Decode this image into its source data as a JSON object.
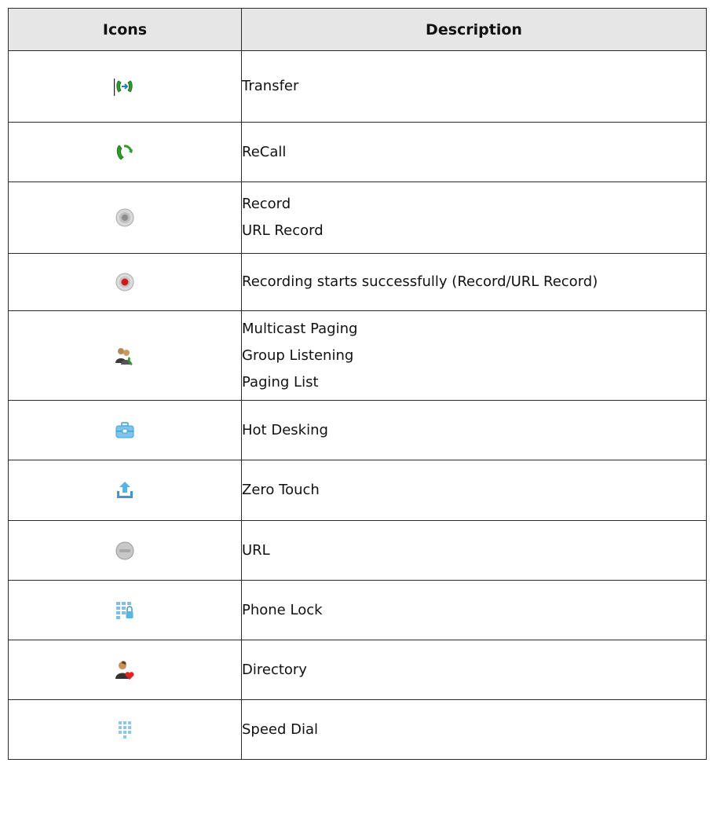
{
  "headers": {
    "icons": "Icons",
    "description": "Description"
  },
  "rows": [
    {
      "icon": "transfer-icon",
      "lines": [
        "Transfer"
      ]
    },
    {
      "icon": "recall-icon",
      "lines": [
        "ReCall"
      ]
    },
    {
      "icon": "record-icon",
      "lines": [
        "Record",
        "URL Record"
      ]
    },
    {
      "icon": "recording-active-icon",
      "lines": [
        "Recording starts successfully (Record/URL Record)"
      ]
    },
    {
      "icon": "multicast-paging-icon",
      "lines": [
        "Multicast Paging",
        "Group Listening",
        "Paging List"
      ]
    },
    {
      "icon": "hot-desking-icon",
      "lines": [
        "Hot Desking"
      ]
    },
    {
      "icon": "zero-touch-icon",
      "lines": [
        "Zero Touch"
      ]
    },
    {
      "icon": "url-icon",
      "lines": [
        "URL"
      ]
    },
    {
      "icon": "phone-lock-icon",
      "lines": [
        "Phone Lock"
      ]
    },
    {
      "icon": "directory-icon",
      "lines": [
        "Directory"
      ]
    },
    {
      "icon": "speed-dial-icon",
      "lines": [
        "Speed Dial"
      ]
    }
  ]
}
